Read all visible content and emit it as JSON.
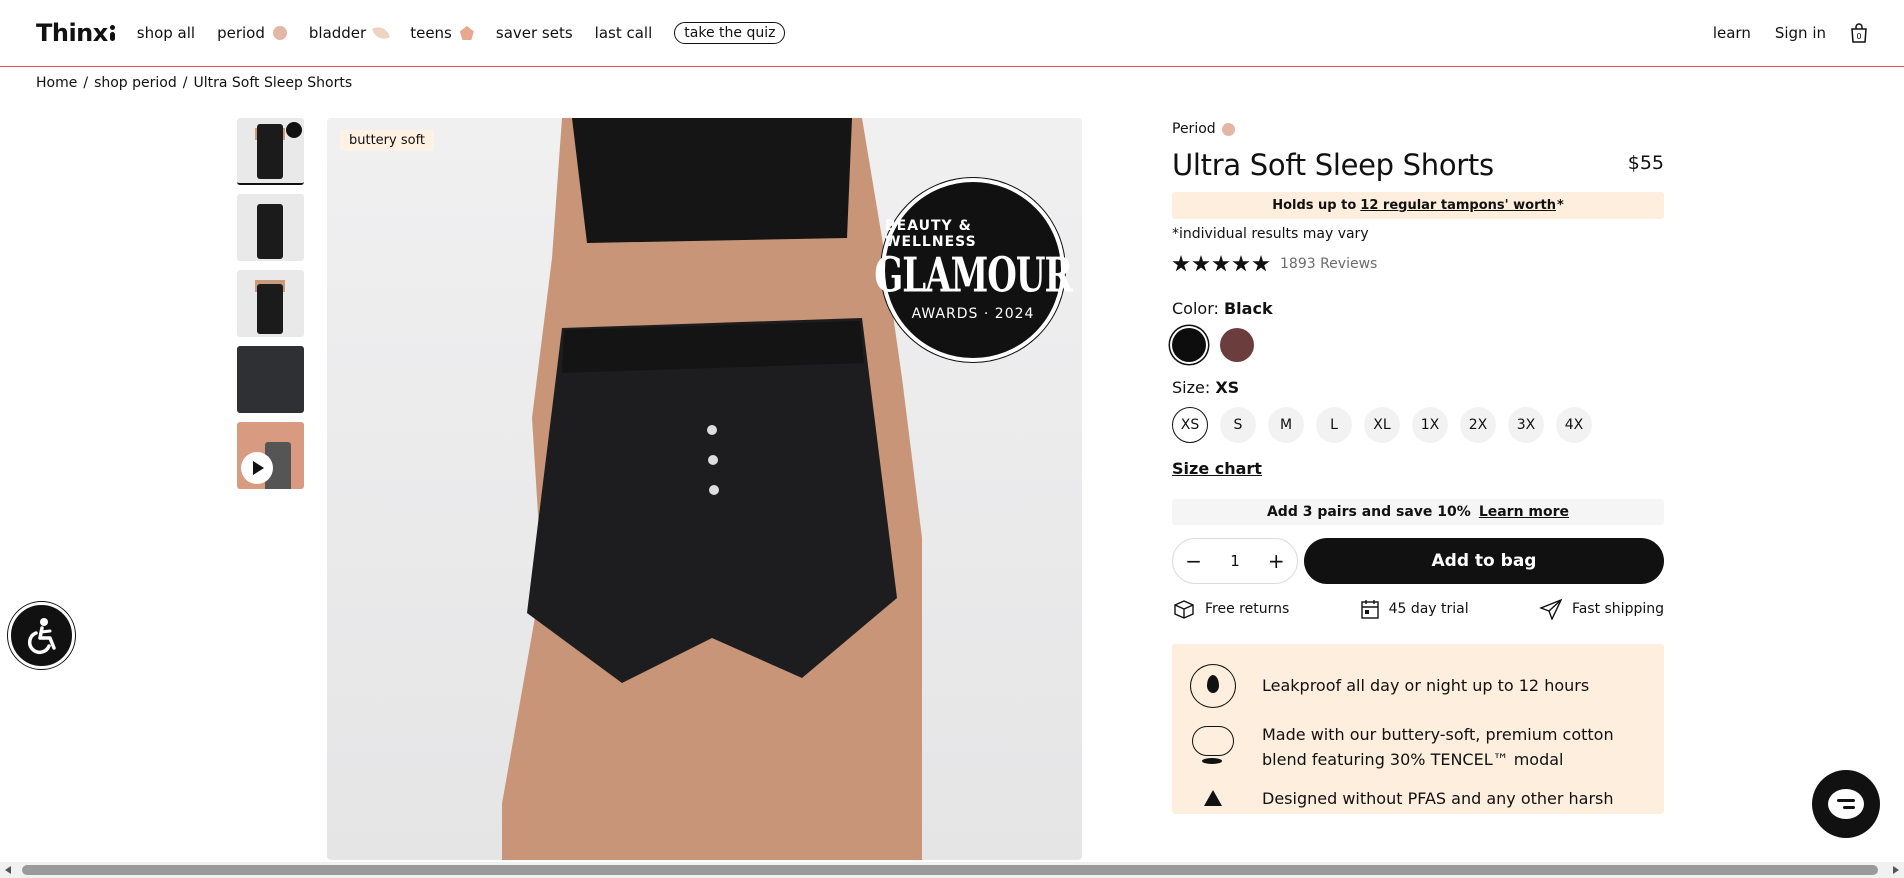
{
  "header": {
    "logo": "Thinx",
    "nav": [
      {
        "label": "shop all"
      },
      {
        "label": "period",
        "icon": "period-dot-icon"
      },
      {
        "label": "bladder",
        "icon": "bladder-leaf-icon"
      },
      {
        "label": "teens",
        "icon": "teens-shape-icon"
      },
      {
        "label": "saver sets"
      },
      {
        "label": "last call"
      },
      {
        "label": "take the quiz"
      }
    ],
    "learn": "learn",
    "sign_in": "Sign in",
    "cart_count": "0"
  },
  "breadcrumb": [
    "Home",
    "shop period",
    "Ultra Soft Sleep Shorts"
  ],
  "gallery": {
    "tag": "buttery soft",
    "badge_top": "BEAUTY & WELLNESS",
    "badge_main": "GLAMOUR",
    "badge_bottom": "AWARDS · 2024",
    "thumb_count": 5
  },
  "product": {
    "category": "Period",
    "title": "Ultra Soft Sleep Shorts",
    "price": "$55",
    "holds_prefix": "Holds up to",
    "holds_link": "12 regular tampons' worth",
    "holds_suffix": "*",
    "disclaimer": "*individual results may vary",
    "rating": 5,
    "reviews": "1893 Reviews",
    "color_label": "Color:",
    "color_value": "Black",
    "colors": [
      "#0d0d0d",
      "#6b3d3d"
    ],
    "size_label": "Size:",
    "size_value": "XS",
    "sizes": [
      "XS",
      "S",
      "M",
      "L",
      "XL",
      "1X",
      "2X",
      "3X",
      "4X"
    ],
    "size_chart": "Size chart",
    "save_text": "Add 3 pairs and save 10%",
    "save_link": "Learn more",
    "qty": "1",
    "add_to_bag": "Add to bag",
    "perks": [
      {
        "label": "Free returns",
        "icon": "box-icon"
      },
      {
        "label": "45 day trial",
        "icon": "calendar-icon"
      },
      {
        "label": "Fast shipping",
        "icon": "paper-plane-icon"
      }
    ],
    "features": [
      {
        "text": "Leakproof all day or night up to 12 hours",
        "icon": "droplet-icon"
      },
      {
        "text": "Made with our buttery-soft, premium cotton blend featuring 30% TENCEL™ modal",
        "icon": "cloud-icon"
      },
      {
        "text": "Designed without PFAS and any other harsh",
        "icon": "triangle-icon"
      }
    ]
  },
  "colors": {
    "accent_line": "#e0554e",
    "highlight": "#fdeedd"
  }
}
